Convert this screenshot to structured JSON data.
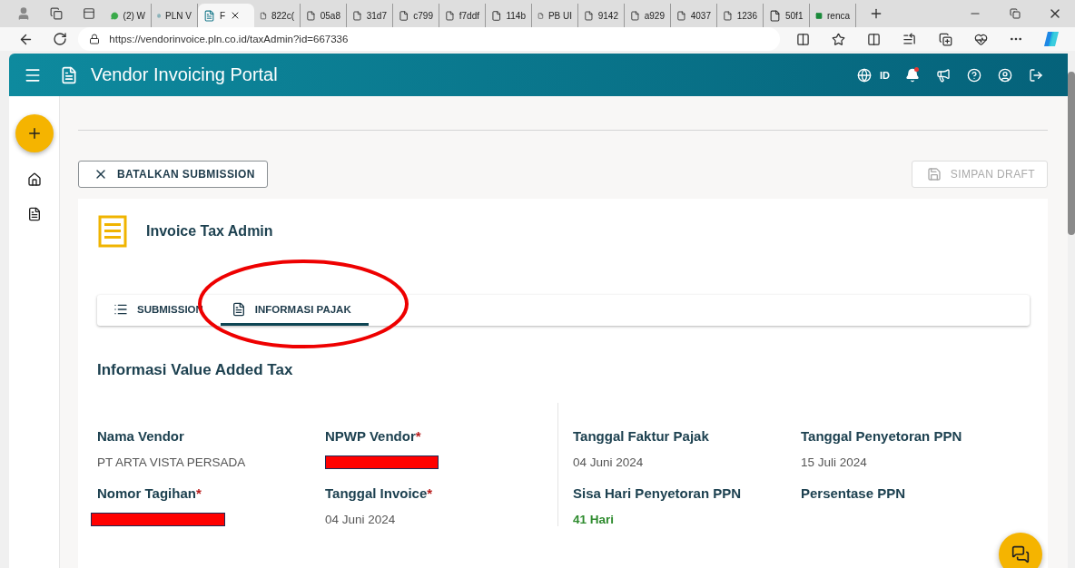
{
  "browser": {
    "tabs": [
      {
        "kind": "chat",
        "title": "(2) W",
        "selected": false
      },
      {
        "kind": "portal",
        "title": "PLN V",
        "selected": false
      },
      {
        "kind": "portal",
        "title": "F",
        "selected": true
      },
      {
        "kind": "page",
        "title": "822c(",
        "selected": false
      },
      {
        "kind": "page",
        "title": "05a8",
        "selected": false
      },
      {
        "kind": "page",
        "title": "31d7",
        "selected": false
      },
      {
        "kind": "page",
        "title": "c799",
        "selected": false
      },
      {
        "kind": "page",
        "title": "f7ddf",
        "selected": false
      },
      {
        "kind": "page",
        "title": "114b",
        "selected": false
      },
      {
        "kind": "page",
        "title": "PB UI",
        "selected": false
      },
      {
        "kind": "page",
        "title": "9142",
        "selected": false
      },
      {
        "kind": "page",
        "title": "a929",
        "selected": false
      },
      {
        "kind": "page",
        "title": "4037",
        "selected": false
      },
      {
        "kind": "page",
        "title": "1236",
        "selected": false
      },
      {
        "kind": "page",
        "title": "50f1",
        "selected": false
      },
      {
        "kind": "sheet",
        "title": "renca",
        "selected": false
      }
    ],
    "url": "https://vendorinvoice.pln.co.id/taxAdmin?id=667336"
  },
  "app": {
    "title": "Vendor Invoicing Portal",
    "language": "ID",
    "notification": true
  },
  "actions": {
    "cancel": {
      "label": "BATALKAN SUBMISSION",
      "disabled": false
    },
    "save": {
      "label": "SIMPAN DRAFT",
      "disabled": true
    }
  },
  "card": {
    "title": "Invoice Tax Admin",
    "tabs": [
      {
        "kind": "list",
        "label": "SUBMISSION",
        "selected": false
      },
      {
        "kind": "doc",
        "label": "INFORMASI PAJAK",
        "selected": true
      }
    ],
    "section_title": "Informasi Value Added Tax",
    "left_fields": [
      {
        "label": "Nama Vendor",
        "value": "PT ARTA VISTA PERSADA",
        "redacted": false
      },
      {
        "label": "NPWP Vendor",
        "mark": "*",
        "redacted": true
      },
      {
        "label": "Nomor Tagihan",
        "mark": "*",
        "redacted": true
      },
      {
        "label": "Tanggal Invoice",
        "mark": "*",
        "value": "04 Juni 2024",
        "redacted": false
      }
    ],
    "right_fields": [
      {
        "label": "Tanggal Faktur Pajak",
        "value": "04 Juni 2024",
        "redacted": false,
        "emphasized": false
      },
      {
        "label": "Tanggal Penyetoran PPN",
        "value": "15 Juli 2024",
        "redacted": false,
        "emphasized": false
      },
      {
        "label": "Sisa Hari Penyetoran PPN",
        "value": "41 Hari",
        "redacted": false,
        "emphasized": true
      },
      {
        "label": "Persentase PPN"
      }
    ]
  },
  "annotation": {
    "kind": "ellipse"
  }
}
